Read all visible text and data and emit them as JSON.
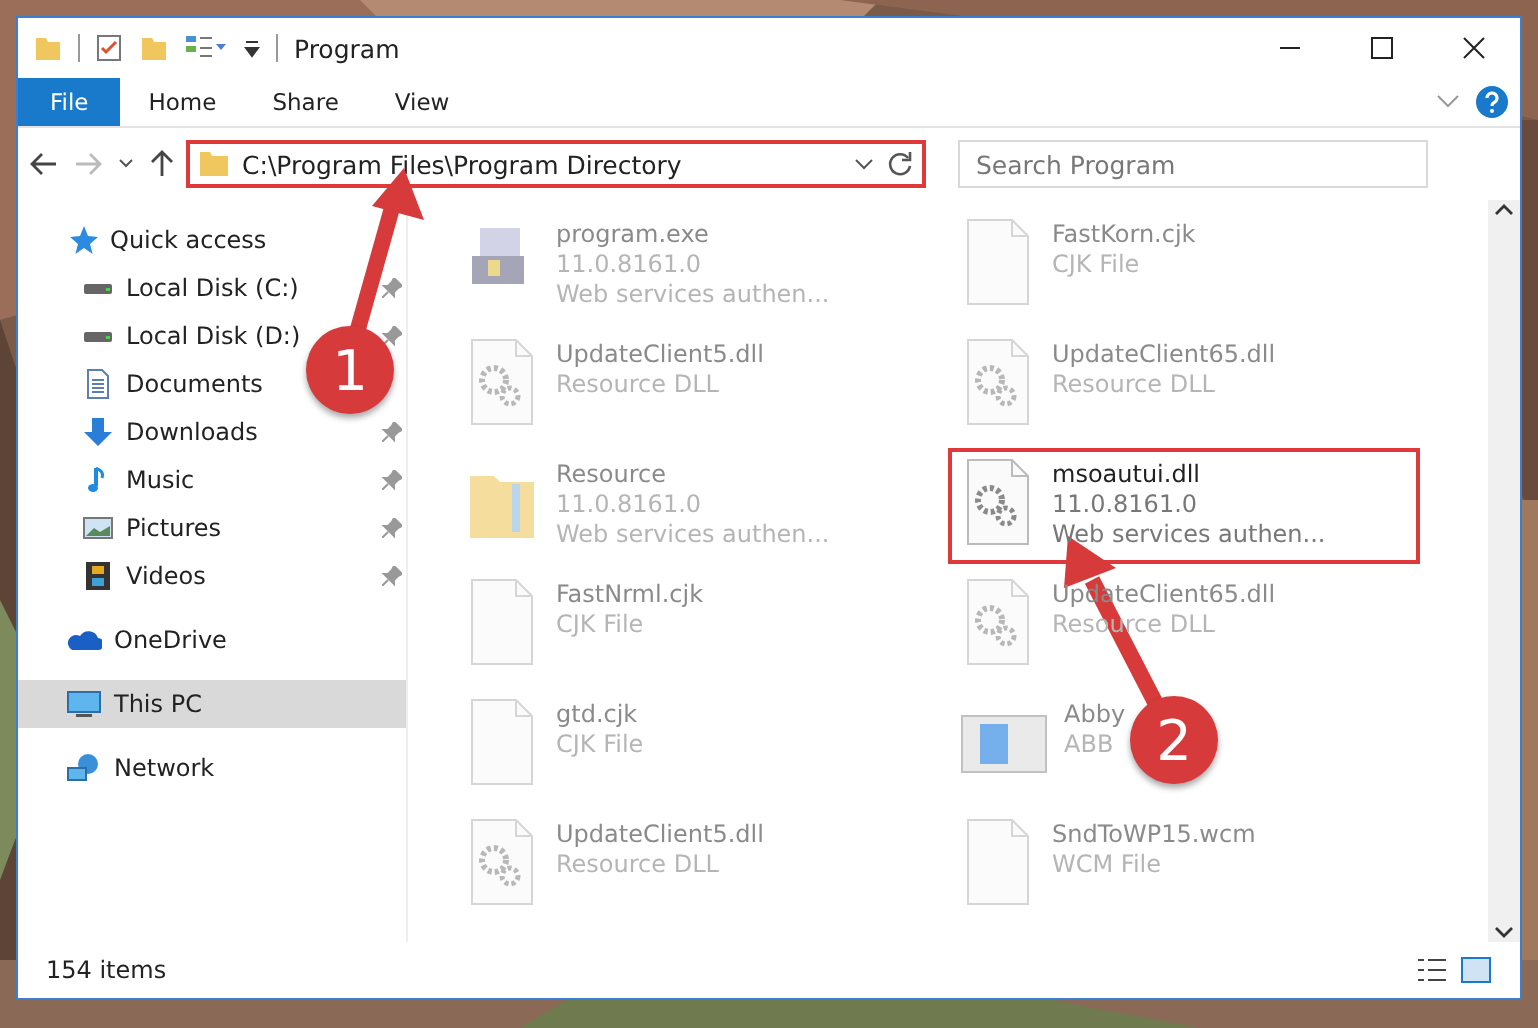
{
  "window": {
    "title": "Program"
  },
  "ribbon": {
    "tabs": [
      {
        "label": "File",
        "selected": true
      },
      {
        "label": "Home",
        "selected": false
      },
      {
        "label": "Share",
        "selected": false
      },
      {
        "label": "View",
        "selected": false
      }
    ]
  },
  "address_bar": {
    "path": "C:\\Program Files\\Program Directory",
    "highlighted": true
  },
  "search": {
    "placeholder": "Search Program"
  },
  "sidebar": {
    "items": [
      {
        "label": "Quick access",
        "selected": false,
        "children": [
          {
            "label": "Local Disk (C:)",
            "pinned": true,
            "selected": false
          },
          {
            "label": "Local Disk (D:)",
            "pinned": true,
            "selected": false
          },
          {
            "label": "Documents",
            "pinned": false,
            "selected": false
          },
          {
            "label": "Downloads",
            "pinned": true,
            "selected": false
          },
          {
            "label": "Music",
            "pinned": true,
            "selected": false
          },
          {
            "label": "Pictures",
            "pinned": true,
            "selected": false
          },
          {
            "label": "Videos",
            "pinned": true,
            "selected": false
          }
        ]
      },
      {
        "label": "OneDrive",
        "selected": false
      },
      {
        "label": "This PC",
        "selected": true
      },
      {
        "label": "Network",
        "selected": false
      }
    ]
  },
  "files": [
    {
      "kind": "exe",
      "name": "program.exe",
      "lines": [
        "11.0.8161.0",
        "Web services authen..."
      ],
      "blurred": true,
      "highlighted": false
    },
    {
      "kind": "blank",
      "name": "FastKorn.cjk",
      "lines": [
        "CJK File"
      ],
      "blurred": true,
      "highlighted": false
    },
    {
      "kind": "dll",
      "name": "UpdateClient5.dll",
      "lines": [
        "Resource DLL"
      ],
      "blurred": true,
      "highlighted": false
    },
    {
      "kind": "dll",
      "name": "UpdateClient65.dll",
      "lines": [
        "Resource DLL"
      ],
      "blurred": true,
      "highlighted": false
    },
    {
      "kind": "folder",
      "name": "Resource",
      "lines": [
        "11.0.8161.0",
        "Web services authen..."
      ],
      "blurred": true,
      "highlighted": false
    },
    {
      "kind": "dll",
      "name": "msoautui.dll",
      "lines": [
        "11.0.8161.0",
        "Web services authen..."
      ],
      "blurred": false,
      "highlighted": true
    },
    {
      "kind": "blank",
      "name": "FastNrml.cjk",
      "lines": [
        "CJK File"
      ],
      "blurred": true,
      "highlighted": false
    },
    {
      "kind": "dll",
      "name": "UpdateClient65.dll",
      "lines": [
        "Resource DLL"
      ],
      "blurred": true,
      "highlighted": false
    },
    {
      "kind": "blank",
      "name": "gtd.cjk",
      "lines": [
        "CJK File"
      ],
      "blurred": true,
      "highlighted": false
    },
    {
      "kind": "app",
      "name": "Abby",
      "lines": [
        "ABB"
      ],
      "blurred": true,
      "highlighted": false
    },
    {
      "kind": "dll",
      "name": "UpdateClient5.dll",
      "lines": [
        "Resource DLL"
      ],
      "blurred": true,
      "highlighted": false
    },
    {
      "kind": "blank",
      "name": "SndToWP15.wcm",
      "lines": [
        "WCM File"
      ],
      "blurred": true,
      "highlighted": false
    }
  ],
  "status_bar": {
    "count": "154 items"
  },
  "annotations": [
    {
      "number": "1"
    },
    {
      "number": "2"
    }
  ]
}
